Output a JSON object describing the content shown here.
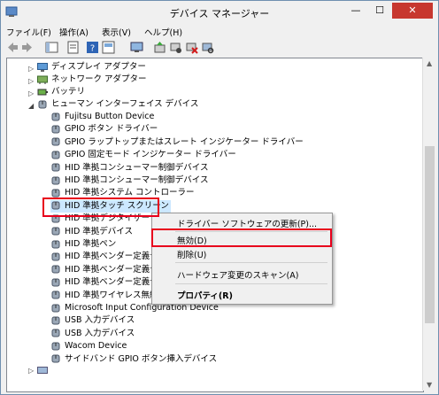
{
  "window": {
    "title": "デバイス マネージャー"
  },
  "menu": [
    "ファイル(F)",
    "操作(A)",
    "表示(V)",
    "ヘルプ(H)"
  ],
  "tree": {
    "categories_top": [
      {
        "label": "ディスプレイ アダプター",
        "icon": "display-icon"
      },
      {
        "label": "ネットワーク アダプター",
        "icon": "network-icon"
      },
      {
        "label": "バッテリ",
        "icon": "battery-icon"
      }
    ],
    "hid_category": "ヒューマン インターフェイス デバイス",
    "hid_devices": [
      "Fujitsu Button Device",
      "GPIO ボタン ドライバー",
      "GPIO ラップトップまたはスレート インジケーター ドライバー",
      "GPIO 固定モード インジケーター ドライバー",
      "HID 準拠コンシューマー制御デバイス",
      "HID 準拠コンシューマー制御デバイス",
      "HID 準拠システム コントローラー",
      "HID 準拠タッチ スクリーン",
      "HID 準拠デジタイザー",
      "HID 準拠デバイス",
      "HID 準拠ペン",
      "HID 準拠ベンダー定義デ",
      "HID 準拠ベンダー定義デ",
      "HID 準拠ベンダー定義デ",
      "HID 準拠ワイヤレス無線",
      "Microsoft Input Configuration Device",
      "USB 入力デバイス",
      "USB 入力デバイス",
      "Wacom Device",
      "サイドバンド GPIO ボタン挿入デバイス"
    ]
  },
  "context_menu": {
    "items": [
      "ドライバー ソフトウェアの更新(P)...",
      "無効(D)",
      "削除(U)",
      "ハードウェア変更のスキャン(A)",
      "プロパティ(R)"
    ]
  }
}
